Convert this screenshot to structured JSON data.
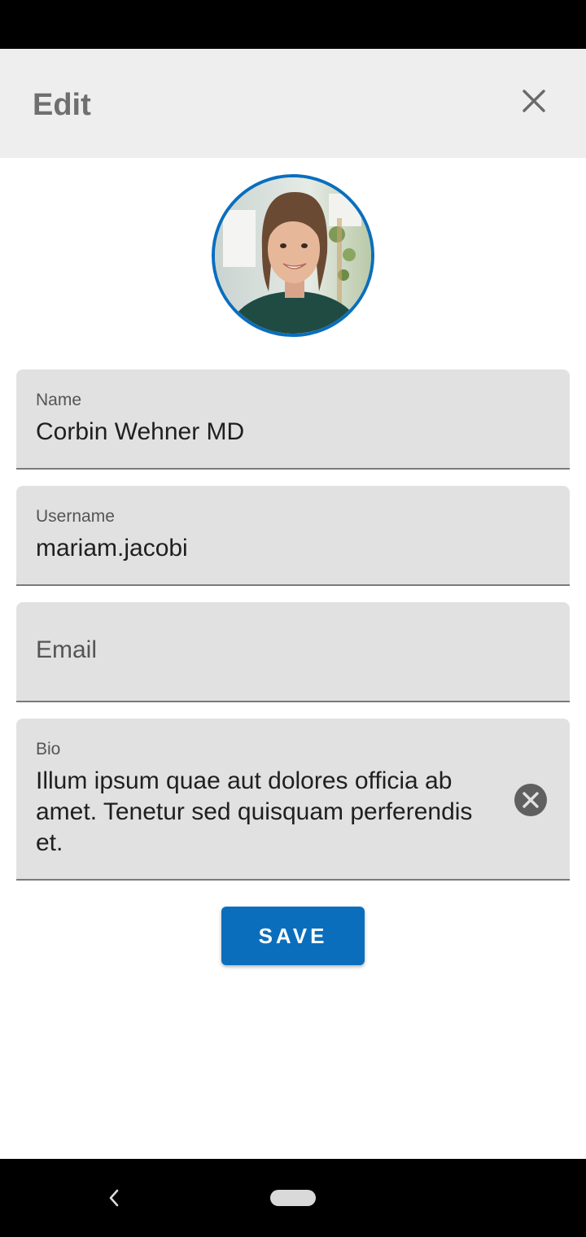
{
  "app_bar": {
    "title": "Edit",
    "close_icon": "close-icon"
  },
  "profile": {
    "avatar_icon": "profile-photo"
  },
  "form": {
    "name": {
      "label": "Name",
      "value": "Corbin Wehner MD"
    },
    "username": {
      "label": "Username",
      "value": "mariam.jacobi"
    },
    "email": {
      "placeholder": "Email",
      "value": ""
    },
    "bio": {
      "label": "Bio",
      "value": "Illum ipsum quae aut dolores officia ab amet. Tenetur sed quisquam perferendis et.",
      "clear_icon": "clear-icon"
    },
    "save_label": "SAVE"
  },
  "colors": {
    "accent": "#0a6ebd",
    "app_bar_bg": "#eeeeee",
    "field_bg": "#e1e1e1"
  },
  "nav": {
    "back_icon": "back-chevron-icon",
    "home_icon": "home-pill-icon"
  }
}
